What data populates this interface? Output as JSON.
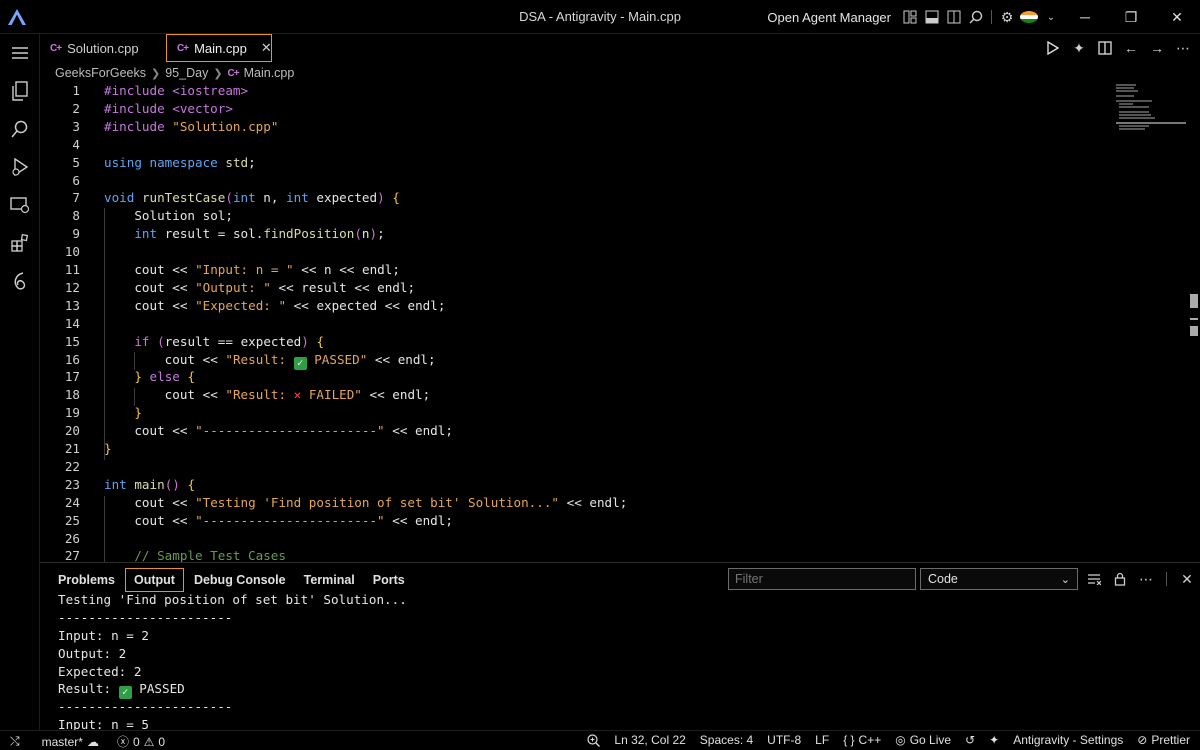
{
  "window": {
    "title": "DSA - Antigravity - Main.cpp",
    "agent_manager_label": "Open Agent Manager"
  },
  "tabs": [
    {
      "label": "Solution.cpp",
      "active": false
    },
    {
      "label": "Main.cpp",
      "active": true
    }
  ],
  "breadcrumb": [
    "GeeksForGeeks",
    "95_Day",
    "Main.cpp"
  ],
  "editor": {
    "lines": [
      {
        "n": "1",
        "text": "#include <iostream>"
      },
      {
        "n": "2",
        "text": "#include <vector>"
      },
      {
        "n": "3",
        "text": "#include \"Solution.cpp\""
      },
      {
        "n": "4",
        "text": ""
      },
      {
        "n": "5",
        "text": "using namespace std;"
      },
      {
        "n": "6",
        "text": ""
      },
      {
        "n": "7",
        "text": "void runTestCase(int n, int expected) {"
      },
      {
        "n": "8",
        "text": "    Solution sol;"
      },
      {
        "n": "9",
        "text": "    int result = sol.findPosition(n);"
      },
      {
        "n": "10",
        "text": ""
      },
      {
        "n": "11",
        "text": "    cout << \"Input: n = \" << n << endl;"
      },
      {
        "n": "12",
        "text": "    cout << \"Output: \" << result << endl;"
      },
      {
        "n": "13",
        "text": "    cout << \"Expected: \" << expected << endl;"
      },
      {
        "n": "14",
        "text": ""
      },
      {
        "n": "15",
        "text": "    if (result == expected) {"
      },
      {
        "n": "16",
        "text": "        cout << \"Result: ✅ PASSED\" << endl;"
      },
      {
        "n": "17",
        "text": "    } else {"
      },
      {
        "n": "18",
        "text": "        cout << \"Result: ❌ FAILED\" << endl;"
      },
      {
        "n": "19",
        "text": "    }"
      },
      {
        "n": "20",
        "text": "    cout << \"-----------------------\" << endl;"
      },
      {
        "n": "21",
        "text": "}"
      },
      {
        "n": "22",
        "text": ""
      },
      {
        "n": "23",
        "text": "int main() {"
      },
      {
        "n": "24",
        "text": "    cout << \"Testing 'Find position of set bit' Solution...\" << endl;"
      },
      {
        "n": "25",
        "text": "    cout << \"-----------------------\" << endl;"
      },
      {
        "n": "26",
        "text": ""
      },
      {
        "n": "27",
        "text": "    // Sample Test Cases"
      }
    ]
  },
  "panel": {
    "tabs": [
      "Problems",
      "Output",
      "Debug Console",
      "Terminal",
      "Ports"
    ],
    "active_tab": "Output",
    "filter_placeholder": "Filter",
    "channel": "Code",
    "output_lines": [
      "Testing 'Find position of set bit' Solution...",
      "-----------------------",
      "Input: n = 2",
      "Output: 2",
      "Expected: 2",
      "Result: ✅ PASSED",
      "-----------------------",
      "Input: n = 5"
    ]
  },
  "statusbar": {
    "branch": "master*",
    "errors": "0",
    "warnings": "0",
    "position": "Ln 32, Col 22",
    "spaces": "Spaces: 4",
    "encoding": "UTF-8",
    "eol": "LF",
    "language": "C++",
    "go_live": "Go Live",
    "settings": "Antigravity - Settings",
    "prettier": "Prettier"
  }
}
